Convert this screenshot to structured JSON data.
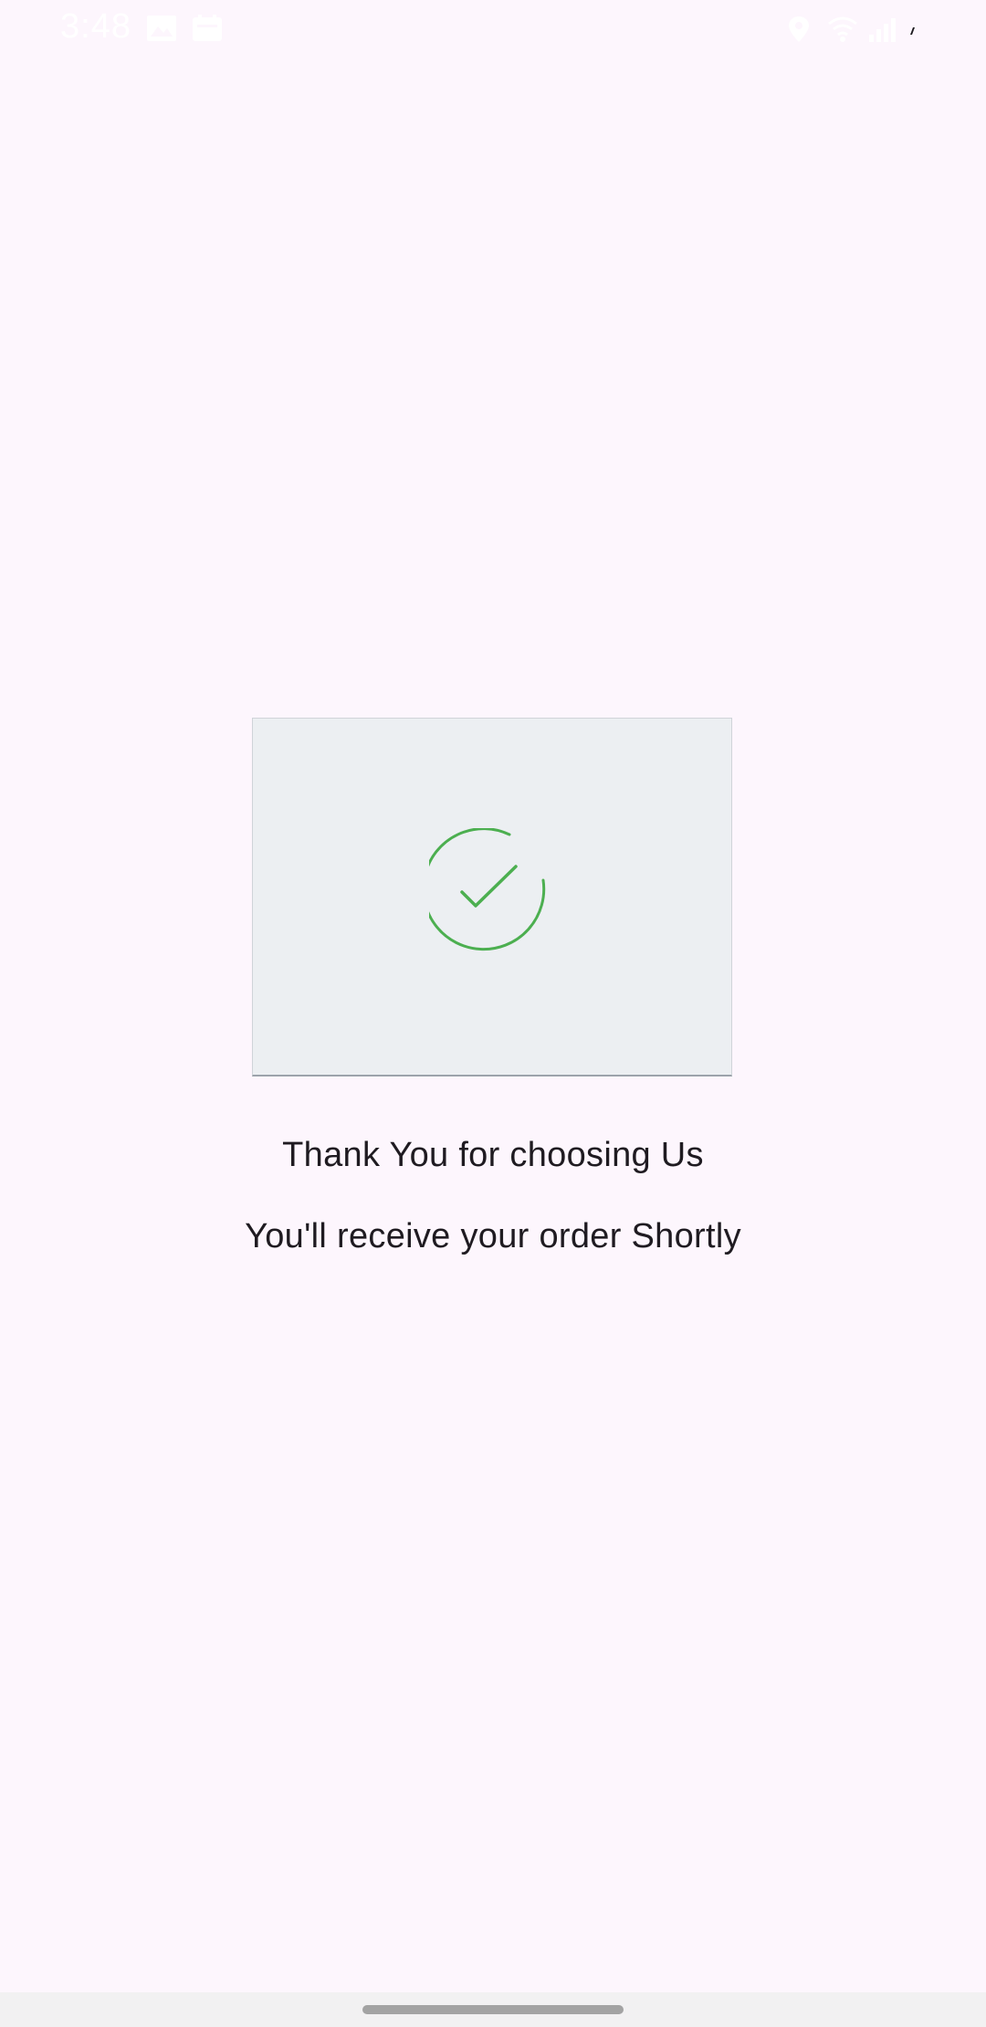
{
  "status_bar": {
    "time": "3:48",
    "left_icons": [
      "image-icon",
      "calendar-icon"
    ],
    "right_icons": [
      "location-icon",
      "wifi-icon",
      "signal-icon",
      "battery-icon"
    ]
  },
  "main": {
    "image_icon": "check-circle-icon",
    "accent_color": "#4caf50",
    "thank_you_text": "Thank You for choosing Us",
    "receive_text": "You'll receive your order Shortly"
  },
  "nav": {
    "handle": "home-indicator"
  }
}
